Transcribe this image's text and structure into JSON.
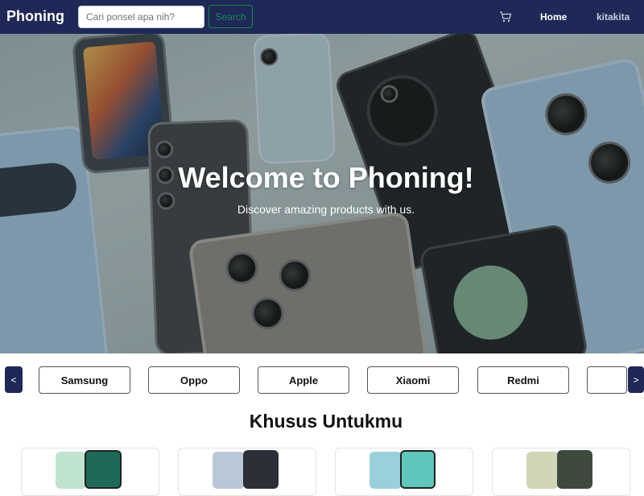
{
  "navbar": {
    "brand": "Phoning",
    "search_placeholder": "Cari ponsel apa nih?",
    "search_button": "Search",
    "cart_icon": "cart-icon",
    "home_link": "Home",
    "user_link": "kitakita",
    "bg_color": "#1e2957"
  },
  "hero": {
    "title": "Welcome to Phoning!",
    "subtitle": "Discover amazing products with us."
  },
  "brands": {
    "prev_label": "<",
    "next_label": ">",
    "items": [
      "Samsung",
      "Oppo",
      "Apple",
      "Xiaomi",
      "Redmi",
      ""
    ]
  },
  "section": {
    "title": "Khusus Untukmu"
  }
}
